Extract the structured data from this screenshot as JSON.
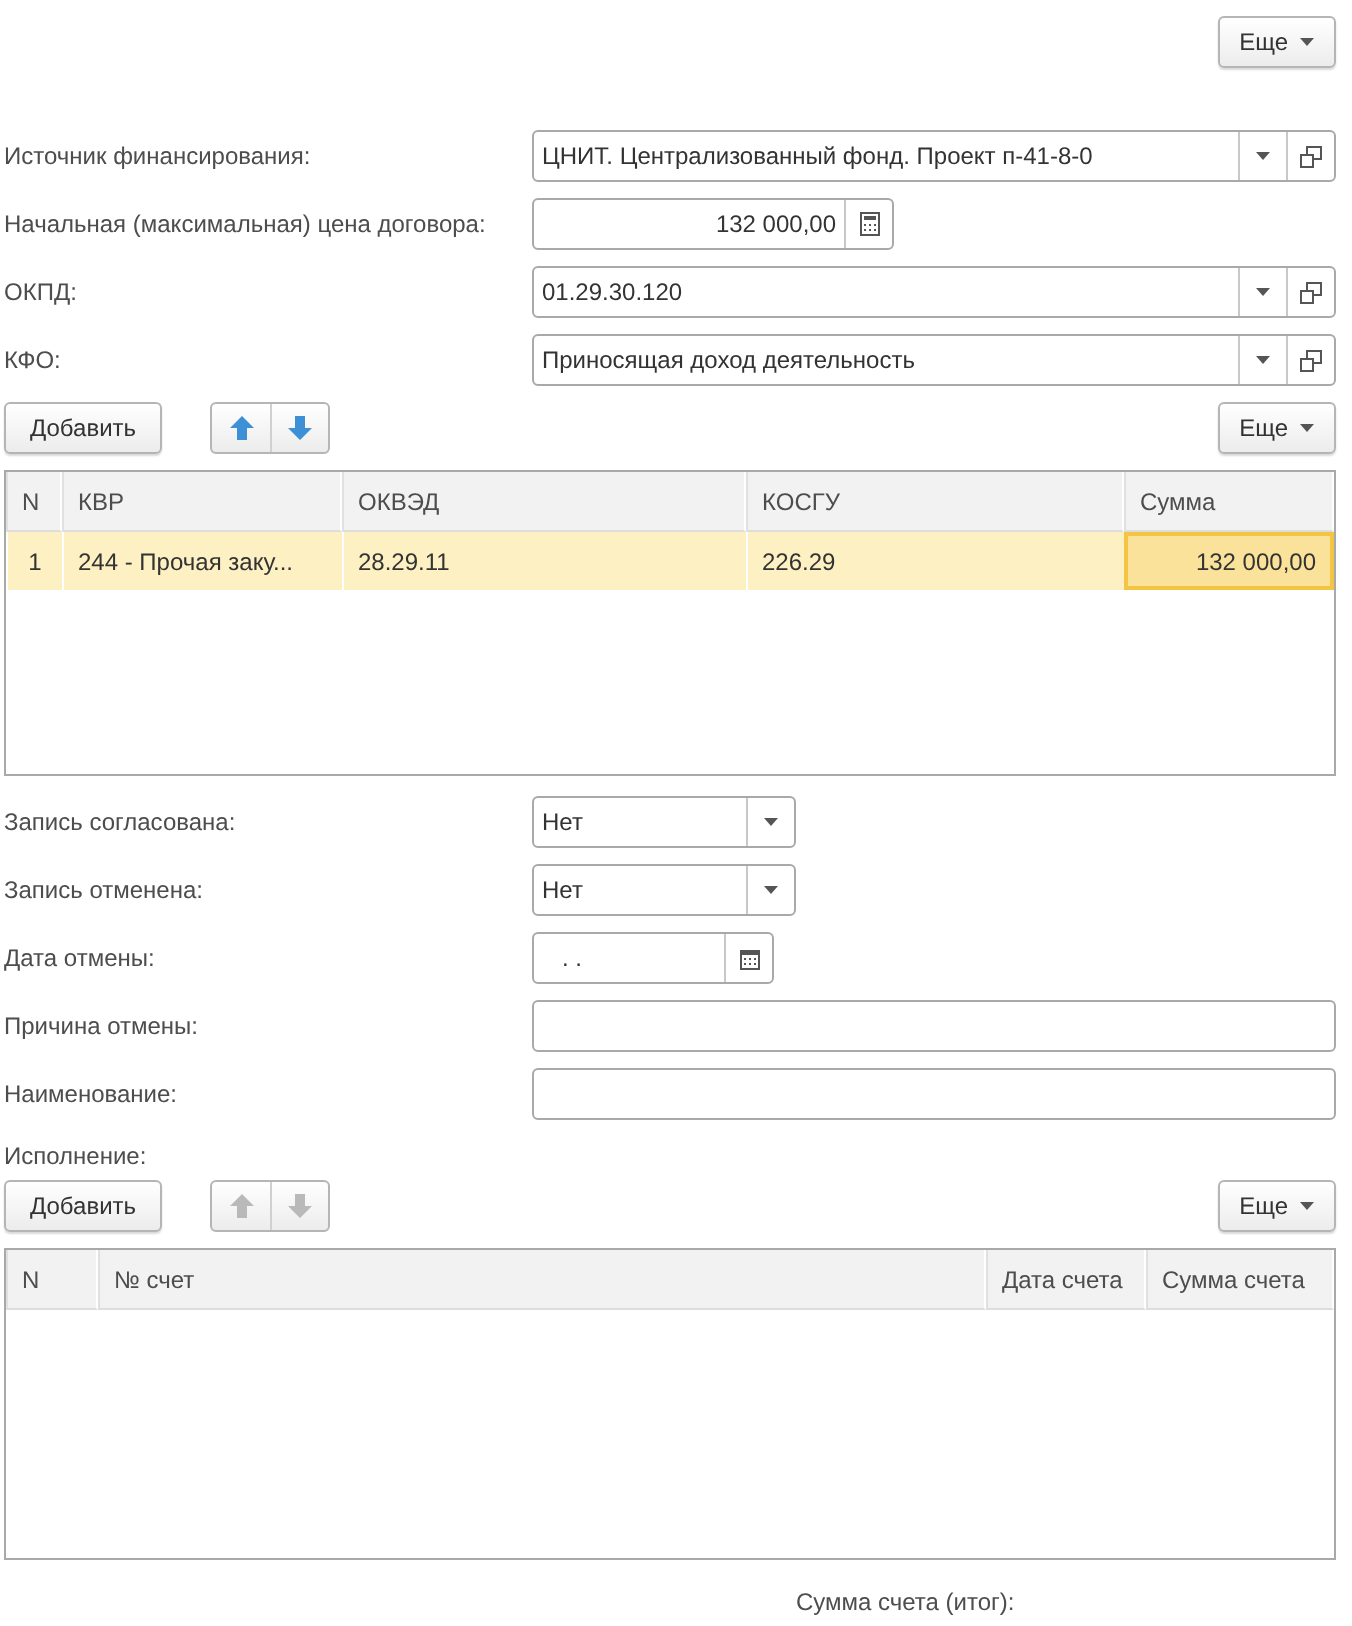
{
  "top_toolbar": {
    "more_button": "Еще"
  },
  "main_fields": [
    {
      "label": "Источник финансирования:",
      "kind": "reference",
      "value": "ЦНИТ. Централизованный фонд. Проект п-41-8-0"
    },
    {
      "label": "Начальная (максимальная) цена договора:",
      "kind": "number",
      "value": "132 000,00"
    },
    {
      "label": "ОКПД:",
      "kind": "reference",
      "value": "01.29.30.120"
    },
    {
      "label": "КФО:",
      "kind": "reference",
      "value": "Приносящая доход деятельность"
    }
  ],
  "budget_table": {
    "toolbar": {
      "add_button": "Добавить",
      "move_up_enabled": true,
      "move_down_enabled": true,
      "more_button": "Еще"
    },
    "columns": [
      "N",
      "КВР",
      "ОКВЭД",
      "КОСГУ",
      "Сумма"
    ],
    "rows": [
      {
        "selected": true,
        "cells": [
          {
            "text": "1",
            "focused": false
          },
          {
            "text": "244 - Прочая заку...",
            "focused": false
          },
          {
            "text": "28.29.11",
            "focused": false
          },
          {
            "text": "226.29",
            "focused": false
          },
          {
            "text": "132 000,00",
            "focused": true
          }
        ]
      }
    ]
  },
  "status_fields": [
    {
      "label": "Запись согласована:",
      "kind": "select",
      "value": "Нет"
    },
    {
      "label": "Запись отменена:",
      "kind": "select",
      "value": "Нет"
    },
    {
      "label": "Дата отмены:",
      "kind": "date",
      "value": ".  ."
    },
    {
      "label": "Причина отмены:",
      "kind": "text"
    },
    {
      "label": "Наименование:",
      "kind": "text"
    }
  ],
  "execution": {
    "title": "Исполнение:",
    "toolbar": {
      "add_button": "Добавить",
      "move_up_enabled": false,
      "move_down_enabled": false,
      "more_button": "Еще"
    },
    "columns": [
      "N",
      "№ счет",
      "Дата счета",
      "Сумма счета"
    ]
  },
  "total_label": "Сумма счета (итог):"
}
